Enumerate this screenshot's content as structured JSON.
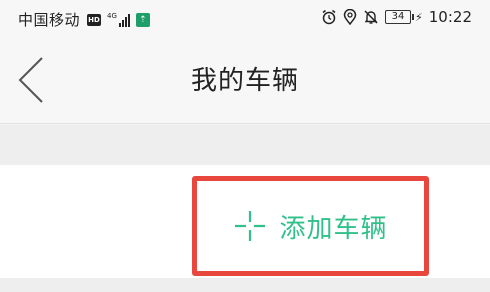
{
  "status_bar": {
    "carrier": "中国移动",
    "hd": "HD",
    "network": "4G",
    "battery": "34",
    "time": "10:22"
  },
  "header": {
    "title": "我的车辆"
  },
  "content": {
    "add_vehicle_label": "添加车辆"
  },
  "colors": {
    "accent": "#32c08a",
    "highlight_box": "#e8473d"
  }
}
